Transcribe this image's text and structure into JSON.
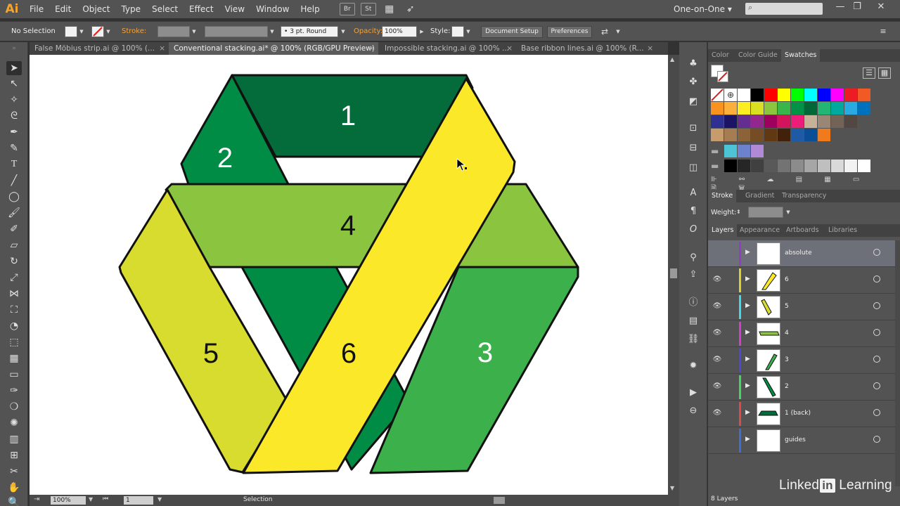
{
  "app": {
    "logo": "Ai",
    "menu": [
      "File",
      "Edit",
      "Object",
      "Type",
      "Select",
      "Effect",
      "View",
      "Window",
      "Help"
    ],
    "bridge_icon": "Br",
    "stock_icon": "St",
    "workspace": "One-on-One",
    "workspace_arrow": "▾"
  },
  "window_controls": {
    "minimize": "—",
    "restore": "❐",
    "close": "✕"
  },
  "control_bar": {
    "selection": "No Selection",
    "stroke_label": "Stroke:",
    "stroke_profile": "3 pt. Round",
    "opacity_label": "Opacity:",
    "opacity_value": "100%",
    "style_label": "Style:",
    "document_setup": "Document Setup",
    "preferences": "Preferences"
  },
  "tabs": [
    {
      "label": "False Möbius strip.ai @ 100% (..."
    },
    {
      "label": "Conventional stacking.ai* @ 100% (RGB/GPU Preview)"
    },
    {
      "label": "Impossible stacking.ai @ 100% ..."
    },
    {
      "label": "Base ribbon lines.ai @ 100% (R..."
    }
  ],
  "tab_close": "×",
  "artwork": {
    "ribbons": [
      {
        "label": "1",
        "fill": "#046c3a"
      },
      {
        "label": "2",
        "fill": "#008c45"
      },
      {
        "label": "3",
        "fill": "#3bb04b"
      },
      {
        "label": "4",
        "fill": "#8bc540"
      },
      {
        "label": "5",
        "fill": "#d8dc2e"
      },
      {
        "label": "6",
        "fill": "#fbe929"
      }
    ]
  },
  "statusbar": {
    "zoom": "100%",
    "artboard": "1",
    "tool": "Selection"
  },
  "swatches_panel": {
    "tabs": [
      "Color",
      "Color Guide",
      "Swatches"
    ]
  },
  "swatch_colors": [
    [
      "#ffffff",
      "#000000",
      "#ff0000",
      "#ffff00",
      "#00ff00",
      "#00ffff",
      "#0000ff",
      "#ff00ff",
      "#ed1c24",
      "#f15a24"
    ],
    [
      "#f7931e",
      "#fbb03b",
      "#fcee21",
      "#d9e021",
      "#8cc63f",
      "#39b54a",
      "#009245",
      "#006837",
      "#22b573",
      "#00a99d",
      "#29abe2",
      "#0071bc"
    ],
    [
      "#2e3192",
      "#1b1464",
      "#662d91",
      "#93278f",
      "#9e005d",
      "#d4145a",
      "#ed1e79",
      "#c7b299",
      "#998675",
      "#736357",
      "#534741"
    ],
    [
      "#c69c6d",
      "#a67c52",
      "#8c6239",
      "#754c24",
      "#603813",
      "#42210b"
    ]
  ],
  "stroke_panel": {
    "tabs": [
      "Stroke",
      "Gradient",
      "Transparency"
    ],
    "weight_label": "Weight:"
  },
  "layers_panel": {
    "tabs": [
      "Layers",
      "Appearance",
      "Artboards",
      "Libraries"
    ],
    "layers": [
      {
        "name": "absolute",
        "color": "#8f3fbf"
      },
      {
        "name": "6",
        "color": "#d6d32a"
      },
      {
        "name": "5",
        "color": "#3fd9e8"
      },
      {
        "name": "4",
        "color": "#d23fcf"
      },
      {
        "name": "3",
        "color": "#4a4ad8"
      },
      {
        "name": "2",
        "color": "#3fd95e"
      },
      {
        "name": "1 (back)",
        "color": "#e04a4a"
      },
      {
        "name": "guides",
        "color": "#3a6fd9"
      }
    ],
    "count": "8 Layers"
  },
  "watermark": {
    "brand": "Linked",
    "in": "in",
    "suffix": "Learning"
  }
}
